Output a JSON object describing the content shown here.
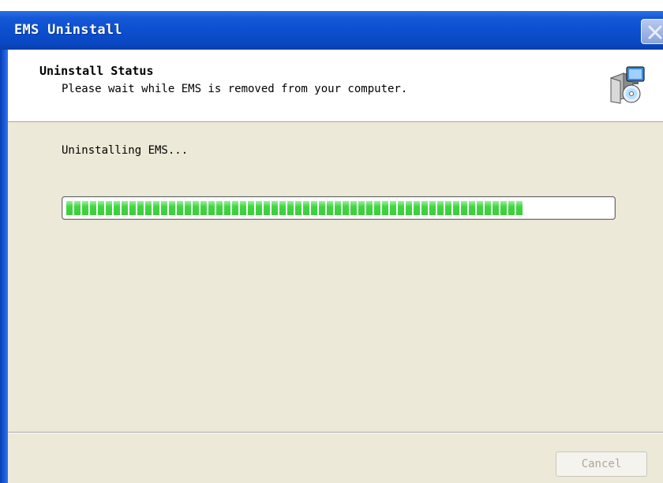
{
  "window": {
    "title": "EMS Uninstall",
    "close_icon": "close-icon"
  },
  "header": {
    "title": "Uninstall Status",
    "subtitle": "Please wait while EMS is removed from your computer.",
    "icon": "installer-package-icon"
  },
  "main": {
    "status_text": "Uninstalling EMS...",
    "progress_fraction": 0.84,
    "progress_color": "#3fd83f"
  },
  "footer": {
    "cancel_label": "Cancel",
    "cancel_enabled": false
  },
  "colors": {
    "titlebar": "#0c4fcf",
    "panel": "#ece9d8"
  }
}
